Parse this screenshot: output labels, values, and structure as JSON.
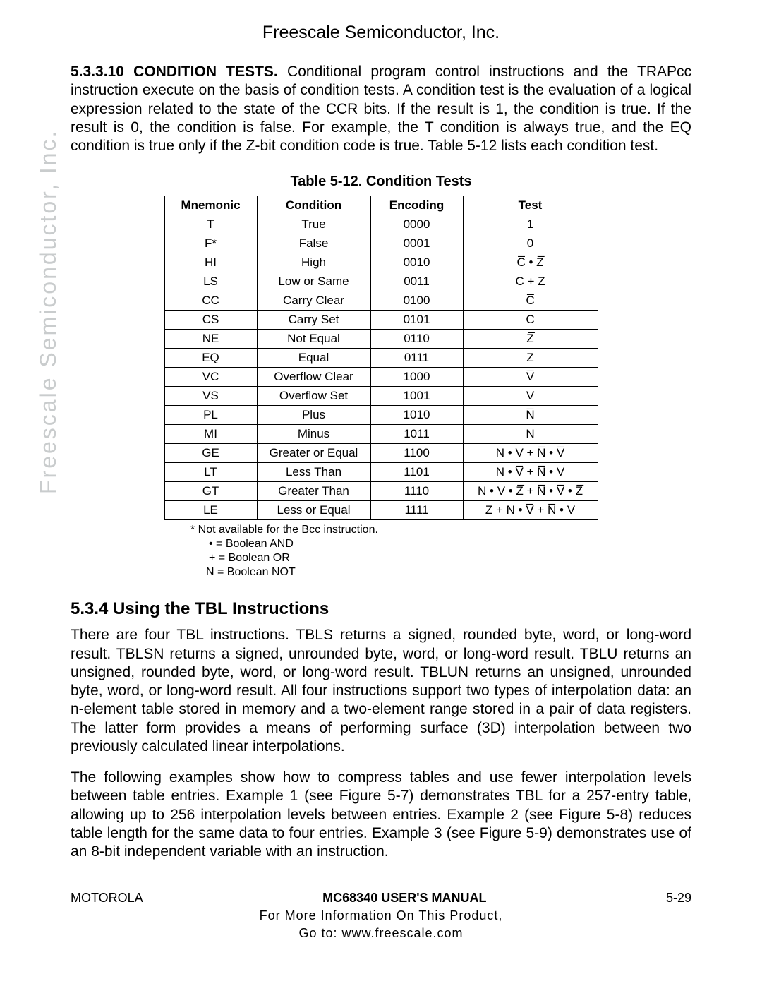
{
  "header": "Freescale Semiconductor, Inc.",
  "watermark": "Freescale Semiconductor, Inc.",
  "para1_lead": "5.3.3.10 CONDITION TESTS.",
  "para1_rest": " Conditional program control instructions and the TRAPcc instruction execute on the basis of condition tests. A condition test is the evaluation of a logical expression related to the state of the CCR bits. If the result is 1, the condition is true. If the result is 0, the condition is false. For example, the T condition is always true, and the EQ condition is true only if the Z-bit condition code is true. Table 5-12 lists each condition test.",
  "table_caption": "Table 5-12. Condition Tests",
  "table_headers": [
    "Mnemonic",
    "Condition",
    "Encoding",
    "Test"
  ],
  "table_rows": [
    {
      "m": "T",
      "c": "True",
      "e": "0000",
      "t": "1",
      "ov": []
    },
    {
      "m": "F*",
      "c": "False",
      "e": "0001",
      "t": "0",
      "ov": []
    },
    {
      "m": "HI",
      "c": "High",
      "e": "0010",
      "t": "C̅ • Z̅",
      "ov": []
    },
    {
      "m": "LS",
      "c": "Low or Same",
      "e": "0011",
      "t": "C + Z",
      "ov": []
    },
    {
      "m": "CC",
      "c": "Carry Clear",
      "e": "0100",
      "t": "C̅",
      "ov": []
    },
    {
      "m": "CS",
      "c": "Carry Set",
      "e": "0101",
      "t": "C",
      "ov": []
    },
    {
      "m": "NE",
      "c": "Not Equal",
      "e": "0110",
      "t": "Z̅",
      "ov": []
    },
    {
      "m": "EQ",
      "c": "Equal",
      "e": "0111",
      "t": "Z",
      "ov": []
    },
    {
      "m": "VC",
      "c": "Overflow Clear",
      "e": "1000",
      "t": "V̅",
      "ov": []
    },
    {
      "m": "VS",
      "c": "Overflow Set",
      "e": "1001",
      "t": "V",
      "ov": []
    },
    {
      "m": "PL",
      "c": "Plus",
      "e": "1010",
      "t": "N̅",
      "ov": []
    },
    {
      "m": "MI",
      "c": "Minus",
      "e": "1011",
      "t": "N",
      "ov": []
    },
    {
      "m": "GE",
      "c": "Greater or Equal",
      "e": "1100",
      "t": "N • V + N̅ • V̅",
      "ov": []
    },
    {
      "m": "LT",
      "c": "Less Than",
      "e": "1101",
      "t": "N • V̅ + N̅ • V",
      "ov": []
    },
    {
      "m": "GT",
      "c": "Greater Than",
      "e": "1110",
      "t": "N • V • Z̅ + N̅ • V̅ • Z̅",
      "ov": []
    },
    {
      "m": "LE",
      "c": "Less or Equal",
      "e": "1111",
      "t": "Z + N • V̅ + N̅ • V",
      "ov": []
    }
  ],
  "footnote_star": "* Not available for the Bcc instruction.",
  "legend_dot": "•   =  Boolean AND",
  "legend_plus": "+   =  Boolean OR",
  "legend_N": "N  =  Boolean NOT",
  "section_heading": "5.3.4 Using the TBL Instructions",
  "para2": "There are four TBL instructions. TBLS returns a signed, rounded byte, word, or long-word result. TBLSN returns a signed, unrounded byte, word, or long-word result. TBLU returns an unsigned, rounded byte, word, or long-word result. TBLUN returns an unsigned, unrounded byte, word, or long-word result. All four instructions support two types of interpolation data: an n-element table stored in memory and a two-element range stored in a pair of data registers. The latter form provides a means of performing surface (3D) interpolation between two previously calculated linear interpolations.",
  "para3": "The following examples show how to compress tables and use fewer interpolation levels between table entries. Example 1 (see Figure 5-7) demonstrates TBL for a 257-entry table, allowing up to 256 interpolation levels between entries. Example 2 (see Figure 5-8) reduces table length for the same data to four entries. Example 3 (see Figure 5-9) demonstrates use of an 8-bit independent variable with an instruction.",
  "footer_left": "MOTOROLA",
  "footer_center": "MC68340 USER'S MANUAL",
  "footer_right": "5-29",
  "footer_line2": "For More Information On This Product,",
  "footer_line3": "Go to: www.freescale.com"
}
